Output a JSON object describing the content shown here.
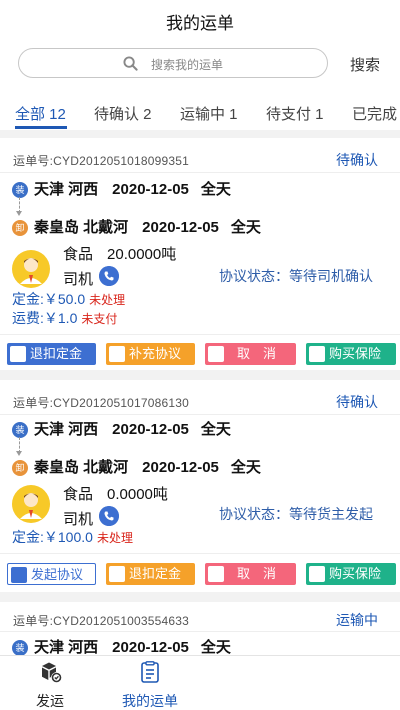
{
  "header": {
    "title": "我的运单",
    "search_placeholder": "搜索我的运单",
    "search_button": "搜索"
  },
  "tabs": [
    {
      "label": "全部 12",
      "active": true
    },
    {
      "label": "待确认 2"
    },
    {
      "label": "运输中 1"
    },
    {
      "label": "待支付 1"
    },
    {
      "label": "已完成"
    }
  ],
  "orders": [
    {
      "order_no": "运单号:CYD2012051018099351",
      "status": "待确认",
      "load_badge": "装",
      "load_place": "天津 河西",
      "load_date": "2020-12-05",
      "load_time": "全天",
      "unload_badge": "卸",
      "unload_place": "秦皇岛 北戴河",
      "unload_date": "2020-12-05",
      "unload_time": "全天",
      "goods": "食品",
      "weight": "20.0000吨",
      "driver_label": "司机",
      "agreement": "协议状态：等待司机确认",
      "deposit_label": "定金:",
      "deposit_amount": "￥50.0",
      "deposit_status": "未处理",
      "freight_label": "运费:",
      "freight_amount": "￥1.0",
      "freight_status": "未支付",
      "actions": [
        "退扣定金",
        "补充协议",
        "取　消",
        "购买保险"
      ]
    },
    {
      "order_no": "运单号:CYD2012051017086130",
      "status": "待确认",
      "load_badge": "装",
      "load_place": "天津 河西",
      "load_date": "2020-12-05",
      "load_time": "全天",
      "unload_badge": "卸",
      "unload_place": "秦皇岛 北戴河",
      "unload_date": "2020-12-05",
      "unload_time": "全天",
      "goods": "食品",
      "weight": "0.0000吨",
      "driver_label": "司机",
      "agreement": "协议状态：等待货主发起",
      "deposit_label": "定金:",
      "deposit_amount": "￥100.0",
      "deposit_status": "未处理",
      "actions": [
        "发起协议",
        "退扣定金",
        "取　消",
        "购买保险"
      ]
    },
    {
      "order_no": "运单号:CYD2012051003554633",
      "status": "运输中",
      "load_badge": "装",
      "load_place": "天津 河西",
      "load_date": "2020-12-05",
      "load_time": "全天"
    }
  ],
  "bottom_nav": [
    {
      "label": "发运",
      "icon": "shipping-box-icon"
    },
    {
      "label": "我的运单",
      "icon": "document-list-icon",
      "active": true
    }
  ],
  "colors": {
    "accent": "#1e58b4",
    "warning": "#d9261c"
  }
}
